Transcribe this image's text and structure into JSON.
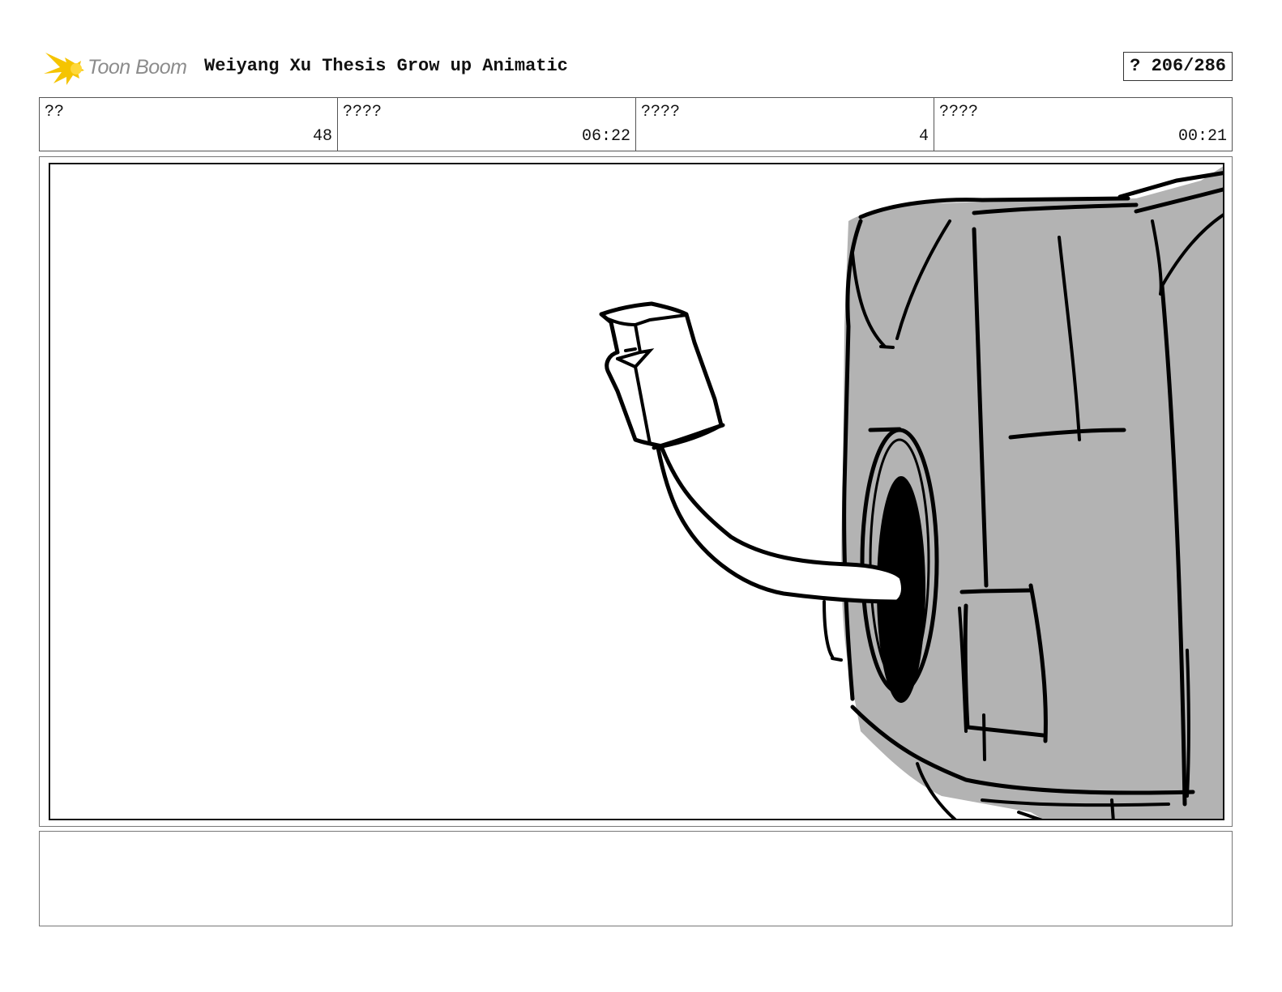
{
  "header": {
    "logo_text": "Toon Boom",
    "title": "Weiyang Xu Thesis Grow up Animatic",
    "page_counter": "? 206/286"
  },
  "info": [
    {
      "label": "??",
      "value": "48"
    },
    {
      "label": "????",
      "value": "06:22"
    },
    {
      "label": "????",
      "value": "4"
    },
    {
      "label": "????",
      "value": "00:21"
    }
  ],
  "panel": {
    "icon": "boxer-sketch-illustration"
  },
  "notes": {
    "text": ""
  },
  "colors": {
    "logo_yellow": "#f5c400",
    "logo_text": "#8c8c8c",
    "sketch_fill": "#b3b3b3",
    "ink": "#000000"
  }
}
